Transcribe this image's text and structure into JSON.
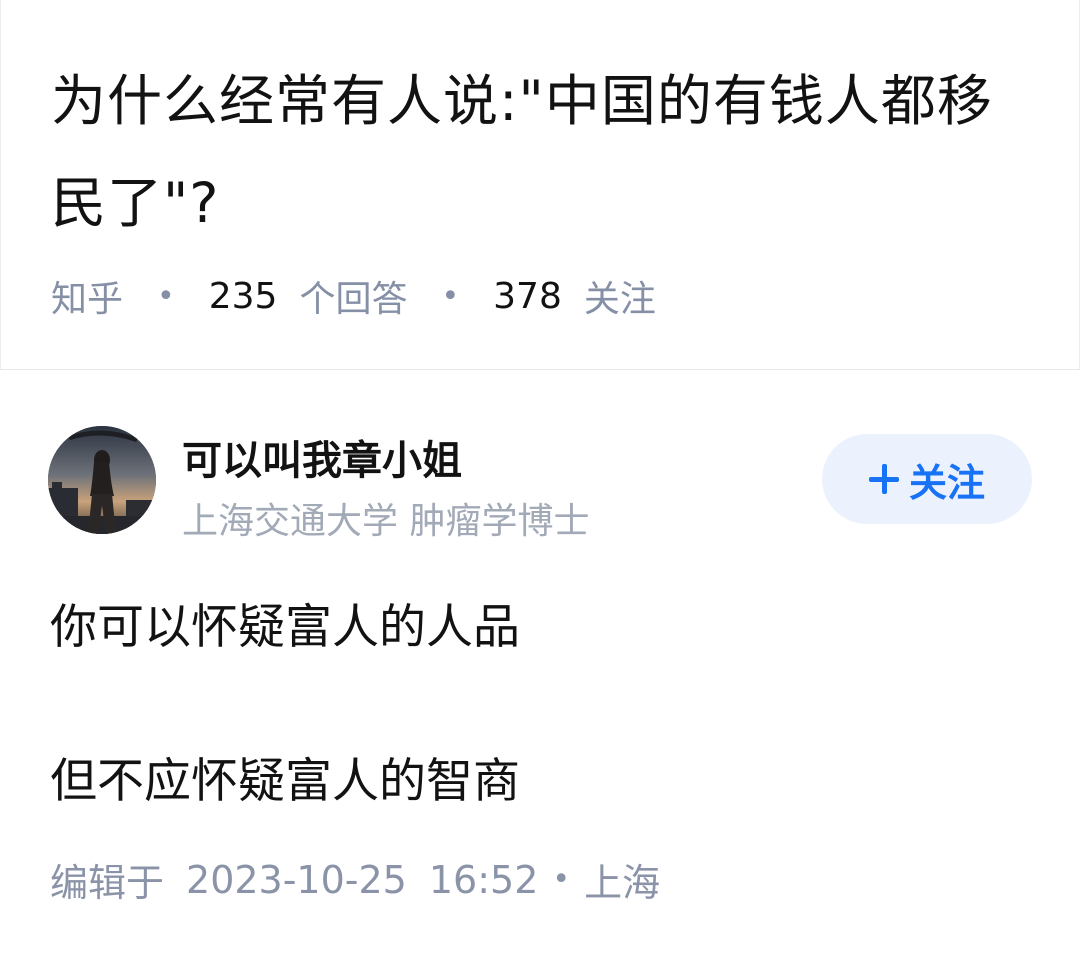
{
  "question": {
    "title": "为什么经常有人说:\"中国的有钱人都移民了\"?",
    "source": "知乎",
    "answers_count": "235",
    "answers_label": "个回答",
    "followers_count": "378",
    "followers_label": "关注"
  },
  "answer": {
    "author": {
      "name": "可以叫我章小姐",
      "bio": "上海交通大学  肿瘤学博士",
      "avatar_icon": "avatar-woman-silhouette"
    },
    "follow_button": {
      "label": "关注",
      "icon": "plus-icon"
    },
    "paragraphs": [
      "你可以怀疑富人的人品",
      "但不应怀疑富人的智商"
    ],
    "meta": {
      "edited_label": "编辑于",
      "date": "2023-10-25",
      "time": "16:52",
      "location": "上海"
    }
  },
  "colors": {
    "accent": "#1772f6",
    "follow_bg": "#ebf2fd",
    "meta_gray": "#8590a6",
    "text": "#121212"
  }
}
